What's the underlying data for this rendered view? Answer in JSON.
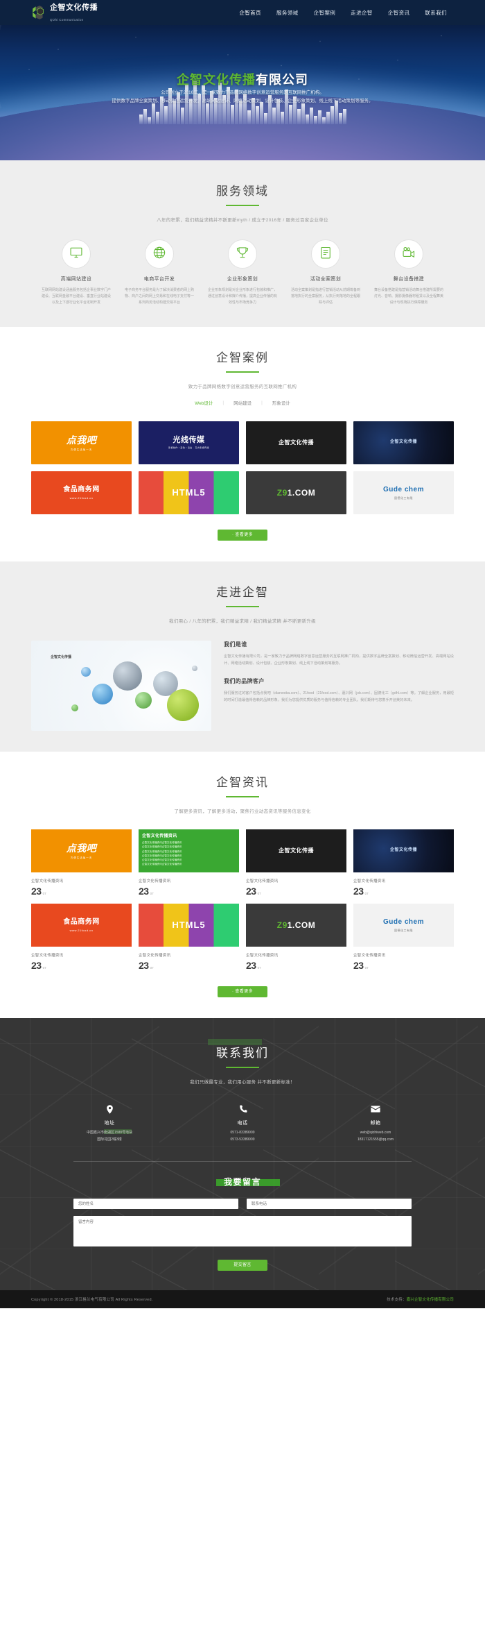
{
  "header": {
    "logo_cn": "企智文化传播",
    "logo_en": "Qizhi Communication",
    "nav": [
      {
        "label": "企智首页",
        "active": true
      },
      {
        "label": "服务领域",
        "active": false
      },
      {
        "label": "企智案例",
        "active": false
      },
      {
        "label": "走进企智",
        "active": false
      },
      {
        "label": "企智资讯",
        "active": false
      },
      {
        "label": "联系我们",
        "active": false
      }
    ]
  },
  "hero": {
    "title_green": "企智文化传播",
    "title_white": "有限公司",
    "sub_line1": "公司创立于2016年，是一家致力于品牌网络数字创意运营服务的互联网推广机构。",
    "sub_line2": "提供数字品牌全案策划、移动微信运营开发、高端网站设计、网络活动策划、设计包装、企业形象策划、线上线下活动策划等服务。"
  },
  "services": {
    "title": "服务领域",
    "desc": "八年的积累，我们精益求精并不断更新myth / 成立于2016年 / 服务过百家企业单位",
    "items": [
      {
        "icon": "monitor-icon",
        "name": "高端网站建设",
        "copy": "互联网网站建设涵盖服务包括企事业数字门户建设、互联网金融平台建设、垂直行业站建设以及上下游行业化平台定制开发"
      },
      {
        "icon": "globe-icon",
        "name": "电商平台开发",
        "copy": "电子商务平台服务是为了解决消费者的网上购物、商户之间的网上交易和在线电子支付等一系列商务活动构建交易平台"
      },
      {
        "icon": "trophy-icon",
        "name": "企业形象策划",
        "copy": "企业形象规划是对企业形象进行包装和推广，通过创意设计和媒介传播，提高企业传播的有效性与市场竞争力"
      },
      {
        "icon": "clipboard-icon",
        "name": "活动全案策划",
        "copy": "活动全案策划是指进行营销活动从前期筹备到落地执行的全案服务，从执行到落地的全程跟踪与评估"
      },
      {
        "icon": "video-camera-icon",
        "name": "舞台设备搭建",
        "copy": "舞台设备搭建是指营销活动舞台搭建所需要的灯光、音响、摄影摄像器材租赁以及全程舞美设计与现场执行保障服务"
      }
    ]
  },
  "cases": {
    "title": "企智案例",
    "desc": "致力于品牌网络数字创意运营服务的互联网推广机构",
    "tabs": [
      {
        "label": "Web设计",
        "active": true
      },
      {
        "label": "网站建设",
        "active": false
      },
      {
        "label": "形象设计",
        "active": false
      }
    ],
    "items": [
      {
        "name": "点我吧",
        "sub": "方便生活每一天",
        "theme": "th-dianwoba"
      },
      {
        "name": "光线传媒",
        "sub": "影视创作 / 活动 / 演出 · 东方影视传媒",
        "theme": "th-guangxian"
      },
      {
        "name": "企智文化传播",
        "sub": "",
        "theme": "th-qizhi"
      },
      {
        "name": "企智文化传播",
        "sub": "",
        "theme": "th-dark-spark"
      },
      {
        "name": "食品商务网",
        "sub": "www.21food.cn",
        "theme": "th-21food"
      },
      {
        "name": "HTML5",
        "sub": "",
        "theme": "th-html5"
      },
      {
        "name": "Z91.COM",
        "sub": "",
        "theme": "th-z91"
      },
      {
        "name": "Gude chem",
        "sub": "固德化工有限",
        "theme": "th-gudechem"
      }
    ],
    "more_label": "· 查看更多"
  },
  "about": {
    "title": "走进企智",
    "desc": "我们用心 / 八年的积累，我们精益求精 / 我们精益求精 并不断更新升级",
    "image_label": "企智文化传播",
    "heading1": "我们是谁",
    "paragraph1": "企智文化传播有限公司，是一家致力于品牌网络数字创意运营服务的互联网推广机构，提供数字品牌全案策划、移动微信运营开发、高端网站设计、网络活动策划、设计包装、企业形象策划、线上线下活动策划等服务。",
    "heading2": "我们的品牌客户",
    "paragraph2": "我们服务过的客户包括点我吧（dianwoba.com）、21food（21food.com）、嘉兴网（jxb.com）、固德化工（gdhl.com）等。了解企业服务，用最短的时间打造最值得信赖的品牌形象，我们为您提供优质的服务与值得信赖的专业团队。我们期待与您携手开创美好未来。"
  },
  "news": {
    "title": "企智资讯",
    "desc": "了解更多资讯，了解更多活动，聚焦行业动态资讯等服务信息变化",
    "items": [
      {
        "theme": "th-dianwoba",
        "name": "点我吧",
        "sub": "方便生活每一天",
        "title": "企智文化传播资讯",
        "day": "23",
        "month": "07"
      },
      {
        "theme": "th-greenlist",
        "name": "企智文化传播资讯",
        "sub": "",
        "title": "企智文化传播资讯",
        "day": "23",
        "month": "07",
        "list": [
          "企智文化传播资讯企智文化传播资讯",
          "企智文化传播资讯企智文化传播资讯",
          "企智文化传播资讯企智文化传播资讯",
          "企智文化传播资讯企智文化传播资讯",
          "企智文化传播资讯企智文化传播资讯",
          "企智文化传播资讯企智文化传播资讯"
        ]
      },
      {
        "theme": "th-qizhi",
        "name": "企智文化传播",
        "sub": "",
        "title": "企智文化传播资讯",
        "day": "23",
        "month": "07"
      },
      {
        "theme": "th-dark-spark",
        "name": "企智文化传播",
        "sub": "",
        "title": "企智文化传播资讯",
        "day": "23",
        "month": "07"
      },
      {
        "theme": "th-21food",
        "name": "食品商务网",
        "sub": "www.21food.cn",
        "title": "企智文化传播资讯",
        "day": "23",
        "month": "07"
      },
      {
        "theme": "th-html5",
        "name": "HTML5",
        "sub": "",
        "title": "企智文化传播资讯",
        "day": "23",
        "month": "07"
      },
      {
        "theme": "th-z91",
        "name": "Z91.COM",
        "sub": "",
        "title": "企智文化传播资讯",
        "day": "23",
        "month": "07"
      },
      {
        "theme": "th-gudechem",
        "name": "Gude chem",
        "sub": "固德化工有限",
        "title": "企智文化传播资讯",
        "day": "23",
        "month": "07"
      }
    ],
    "more_label": "· 查看更多"
  },
  "contact": {
    "title": "联系我们",
    "desc": "我们只做最专业，我们用心服务 并不断更新标准！",
    "columns": [
      {
        "icon": "location-pin-icon",
        "name": "地址",
        "value": "中国嘉兴市南湖区1588号地块\n国际花园2幢3楼"
      },
      {
        "icon": "phone-icon",
        "name": "电话",
        "value": "0571-83389909\n0573-53389909"
      },
      {
        "icon": "mail-icon",
        "name": "邮箱",
        "value": "web@qizhiweb.com\n18317121555@qq.com"
      }
    ],
    "form_title": "我要留言",
    "name_placeholder": "您的姓名",
    "phone_placeholder": "联系电话",
    "message_placeholder": "留言内容",
    "submit_label": "提交留言"
  },
  "footer": {
    "copyright": "Copyright © 2018-2015 浙江格兰电气有限公司 All Rights Reserved.",
    "support_prefix": "技术支持：",
    "support_name": "嘉兴企智文化传播有限公司"
  },
  "colors": {
    "brand_green": "#5fb832",
    "header_navy": "#0d2240",
    "dark_section": "#3b3b3b",
    "footer_black": "#161616"
  }
}
